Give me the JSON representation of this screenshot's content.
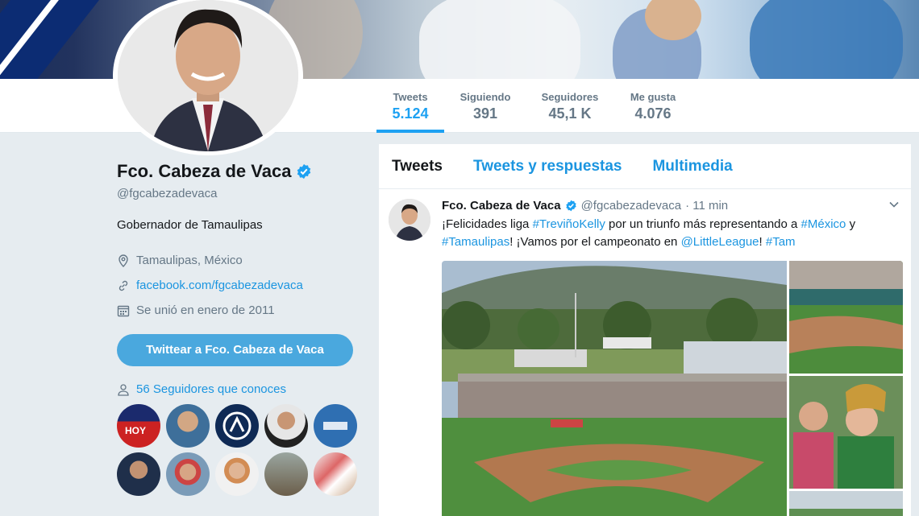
{
  "profile": {
    "name": "Fco. Cabeza de Vaca",
    "handle": "@fgcabezadevaca",
    "bio": "Gobernador de Tamaulipas",
    "location": "Tamaulipas, México",
    "website": "facebook.com/fgcabezadevaca",
    "joined": "Se unió en enero de 2011",
    "tweet_button": "Twittear a Fco. Cabeza de Vaca",
    "followers_you_know": "56 Seguidores que conoces"
  },
  "stats": [
    {
      "label": "Tweets",
      "value": "5.124",
      "active": true
    },
    {
      "label": "Siguiendo",
      "value": "391",
      "active": false
    },
    {
      "label": "Seguidores",
      "value": "45,1 K",
      "active": false
    },
    {
      "label": "Me gusta",
      "value": "4.076",
      "active": false
    }
  ],
  "tabs": [
    {
      "label": "Tweets",
      "active": true
    },
    {
      "label": "Tweets y respuestas",
      "active": false
    },
    {
      "label": "Multimedia",
      "active": false
    }
  ],
  "tweet": {
    "name": "Fco. Cabeza de Vaca",
    "handle": "@fgcabezadevaca",
    "time": "· 11 min",
    "segments": [
      {
        "text": "¡Felicidades liga ",
        "link": false
      },
      {
        "text": "#TreviñoKelly",
        "link": true
      },
      {
        "text": " por un triunfo más representando a ",
        "link": false
      },
      {
        "text": "#México",
        "link": true
      },
      {
        "text": " y ",
        "link": false
      },
      {
        "text": "#Tamaulipas",
        "link": true
      },
      {
        "text": "! ¡Vamos por el campeonato en ",
        "link": false
      },
      {
        "text": "@LittleLeague",
        "link": true
      },
      {
        "text": "! ",
        "link": false
      },
      {
        "text": "#Tam",
        "link": true
      }
    ]
  },
  "follower_avatars": [
    {
      "name": "hoy-tamaulipas",
      "text": "HOY"
    },
    {
      "name": "sunglasses-man"
    },
    {
      "name": "logo-circle"
    },
    {
      "name": "suit-man"
    },
    {
      "name": "educacion-logo"
    },
    {
      "name": "man-portrait"
    },
    {
      "name": "cap-man"
    },
    {
      "name": "woman-portrait"
    },
    {
      "name": "outdoor-photo"
    },
    {
      "name": "crowd-photo"
    }
  ],
  "colors": {
    "accent": "#1da1f2",
    "link": "#1b95e0",
    "button": "#4aa8de",
    "background": "#e6ecf0"
  },
  "icons": {
    "location": "map-pin-icon",
    "website": "link-icon",
    "joined": "calendar-icon",
    "followers": "person-icon",
    "verified": "verified-badge-icon",
    "menu": "chevron-down-icon"
  }
}
